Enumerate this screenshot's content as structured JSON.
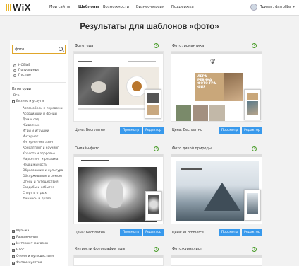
{
  "header": {
    "logo": "WiX",
    "nav": [
      {
        "label": "Мои сайты"
      },
      {
        "label": "Шаблоны"
      },
      {
        "label": "Возможности"
      },
      {
        "label": "Бизнес-версия"
      },
      {
        "label": "Поддержка"
      }
    ],
    "user_greeting": "Привет, dasrollbs"
  },
  "page": {
    "title": "Результаты для шаблонов «фото»"
  },
  "sidebar": {
    "search_value": "фото",
    "filters": [
      "НОВЫЕ",
      "Популярные",
      "Пустые"
    ],
    "categories_title": "Категории",
    "categories": [
      {
        "label": "Все",
        "expand": ""
      },
      {
        "label": "Бизнес и услуги",
        "expand": "−"
      }
    ],
    "subcategories": [
      "Автомобили и перевозки",
      "Ассоциации и фонды",
      "Дом и сад",
      "Животные",
      "Игры и игрушки",
      "Интернет",
      "Интернет-магазин",
      "Консалтинг и коучинг",
      "Красота и здоровье",
      "Маркетинг и реклама",
      "Недвижимость",
      "Образование и культура",
      "Обслуживание и ремонт",
      "Отели и путешествия",
      "Свадьбы и события",
      "Спорт и отдых",
      "Финансы и право"
    ],
    "more_categories": [
      {
        "label": "Музыка",
        "expand": "+"
      },
      {
        "label": "Развлечения",
        "expand": "+"
      },
      {
        "label": "Интернет-магазин",
        "expand": "+"
      },
      {
        "label": "Блог",
        "expand": "+"
      },
      {
        "label": "Отели и путешествия",
        "expand": "+"
      },
      {
        "label": "Фотоискусство",
        "expand": "+"
      }
    ]
  },
  "cards": [
    {
      "title": "Фото: еда",
      "price": "Цена: Бесплатно",
      "preview": "Просмотр",
      "edit": "Редактор"
    },
    {
      "title": "Фото: романтика",
      "price": "Цена: Бесплатно",
      "preview": "Просмотр",
      "edit": "Редактор",
      "hero_text": "ЛЕРА РЕВИНА ФОТО-ГРА-ФИЯ"
    },
    {
      "title": "Онлайн-фото",
      "price": "Цена: Бесплатно",
      "preview": "Просмотр",
      "edit": "Редактор"
    },
    {
      "title": "Фото дикой природы",
      "price": "Цена: eCommerce",
      "preview": "Просмотр",
      "edit": "Редактор"
    },
    {
      "title": "Хитрости фотографии еды",
      "price": "",
      "preview": "",
      "edit": ""
    },
    {
      "title": "Фотожурналист",
      "price": "",
      "preview": "",
      "edit": ""
    }
  ],
  "colors": {
    "accent": "#3899ec",
    "info": "#4a9d2a",
    "search_border": "#e0a62a"
  }
}
